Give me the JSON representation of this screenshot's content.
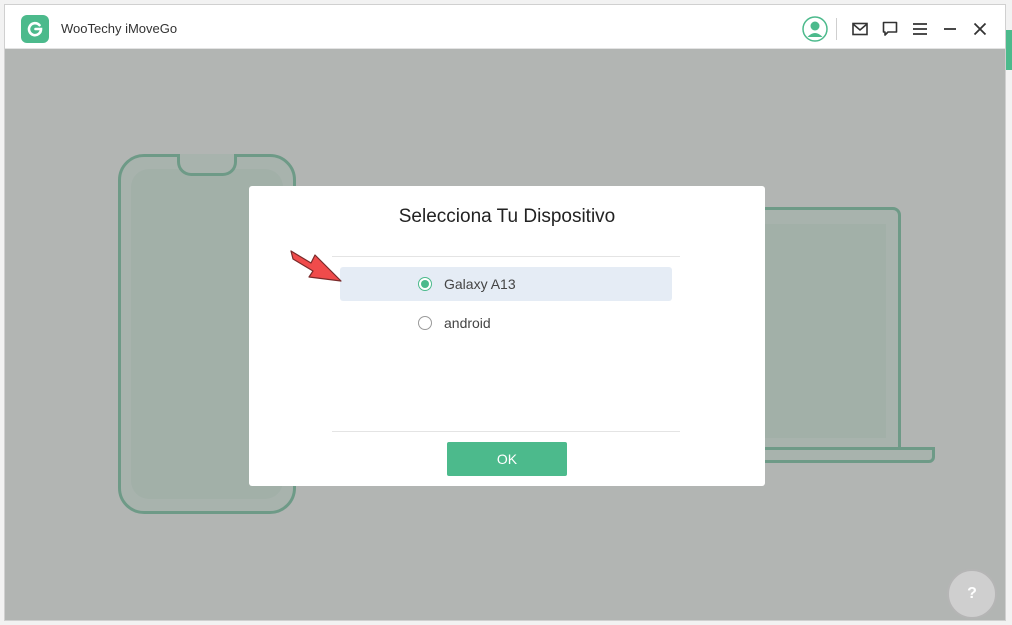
{
  "window": {
    "title": "WooTechy iMoveGo"
  },
  "titlebar_icons": [
    "user-icon",
    "mail-icon",
    "feedback-icon",
    "menu-icon",
    "minimize-icon",
    "close-icon"
  ],
  "dialog": {
    "title": "Selecciona Tu Dispositivo",
    "options": [
      {
        "label": "Galaxy A13",
        "selected": true
      },
      {
        "label": "android",
        "selected": false
      }
    ],
    "ok_label": "OK"
  },
  "colors": {
    "accent": "#4cba8c",
    "overlay": "#828282",
    "selected_row": "#e5ecf5",
    "arrow": "#f04b4b"
  }
}
